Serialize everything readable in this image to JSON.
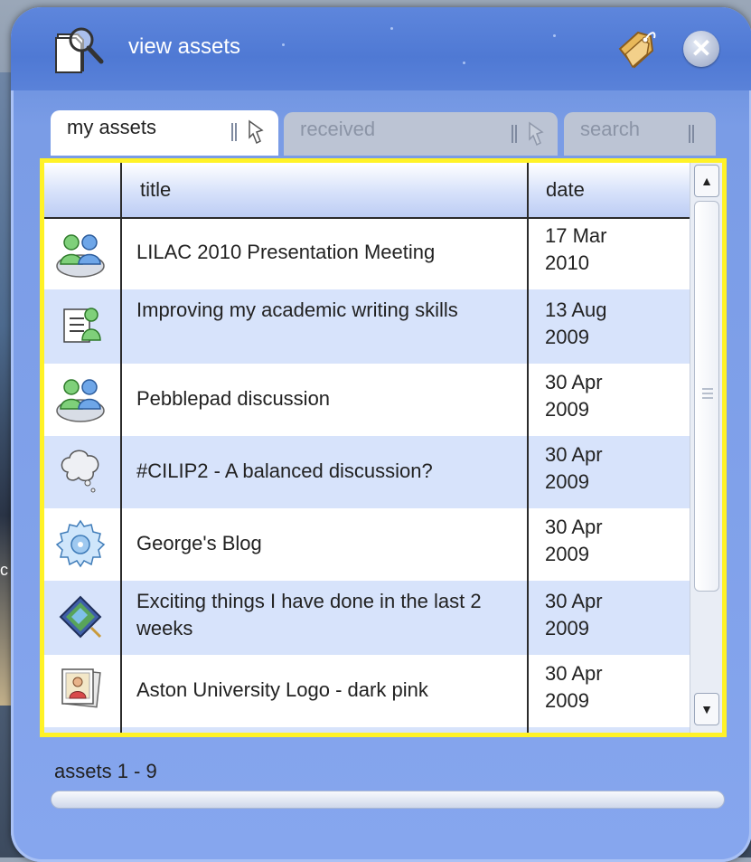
{
  "window": {
    "title": "view assets"
  },
  "tabs": [
    {
      "label": "my assets",
      "active": true
    },
    {
      "label": "received",
      "active": false
    },
    {
      "label": "search",
      "active": false
    }
  ],
  "grid": {
    "columns": {
      "icon": "",
      "title": "title",
      "date": "date"
    },
    "rows": [
      {
        "icon": "people-group-icon",
        "title": "LILAC 2010 Presentation Meeting",
        "date_line1": "17 Mar",
        "date_line2": "2010"
      },
      {
        "icon": "document-person-icon",
        "title": "Improving my academic writing skills",
        "date_line1": "13 Aug",
        "date_line2": "2009"
      },
      {
        "icon": "people-group-icon",
        "title": "Pebblepad discussion",
        "date_line1": "30 Apr",
        "date_line2": "2009"
      },
      {
        "icon": "thought-bubble-icon",
        "title": "#CILIP2 - A balanced discussion?",
        "date_line1": "30 Apr",
        "date_line2": "2009"
      },
      {
        "icon": "gear-blog-icon",
        "title": "George's Blog",
        "date_line1": "30 Apr",
        "date_line2": "2009"
      },
      {
        "icon": "map-book-icon",
        "title": "Exciting things I have done in the last 2 weeks",
        "date_line1": "30 Apr",
        "date_line2": "2009"
      },
      {
        "icon": "image-photo-icon",
        "title": "Aston University Logo - dark pink",
        "date_line1": "30 Apr",
        "date_line2": "2009"
      }
    ]
  },
  "status": {
    "text": "assets 1 - 9"
  },
  "colors": {
    "highlight_border": "#fff227",
    "row_alt": "#d7e3fb",
    "panel": "#7a9ce6"
  }
}
